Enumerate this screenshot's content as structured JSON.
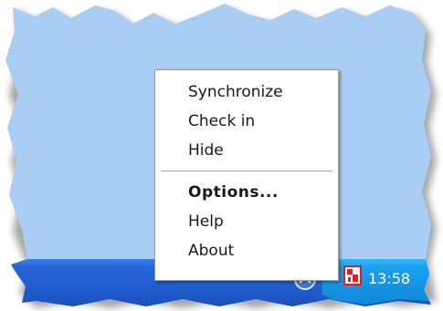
{
  "menu": {
    "items": [
      {
        "label": "Synchronize",
        "bold": false
      },
      {
        "label": "Check in",
        "bold": false
      },
      {
        "label": "Hide",
        "bold": false
      },
      {
        "label": "Options...",
        "bold": true
      },
      {
        "label": "Help",
        "bold": false
      },
      {
        "label": "About",
        "bold": false
      }
    ]
  },
  "tray": {
    "clock": "13:58",
    "icons": [
      "network-icon",
      "app-tray-icon"
    ]
  },
  "colors": {
    "desktop": "#a9cdf3",
    "taskbar": "#1f5fd0",
    "tray": "#1aa0f0",
    "menu_border": "#9c9c9c",
    "separator": "#aca899",
    "app_icon_red": "#e02020"
  }
}
